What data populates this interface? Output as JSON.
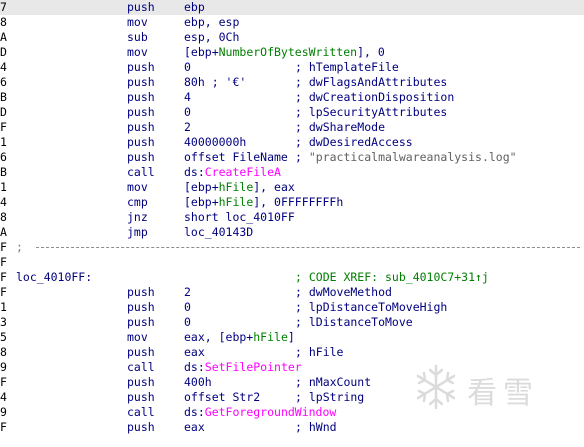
{
  "rows": [
    {
      "addr": "7",
      "label": "",
      "mnem": "push",
      "ops": [
        {
          "t": "ebp"
        }
      ],
      "comment": [],
      "hl": true
    },
    {
      "addr": "8",
      "label": "",
      "mnem": "mov",
      "ops": [
        {
          "t": "ebp, esp"
        }
      ],
      "comment": []
    },
    {
      "addr": "A",
      "label": "",
      "mnem": "sub",
      "ops": [
        {
          "t": "esp, 0Ch"
        }
      ],
      "comment": []
    },
    {
      "addr": "D",
      "label": "",
      "mnem": "mov",
      "ops": [
        {
          "t": "[ebp+"
        },
        {
          "t": "NumberOfBytesWritten",
          "c": "ref"
        },
        {
          "t": "], 0"
        }
      ],
      "comment": []
    },
    {
      "addr": "4",
      "label": "",
      "mnem": "push",
      "ops": [
        {
          "t": "0"
        }
      ],
      "comment": [
        {
          "t": "; hTemplateFile"
        }
      ]
    },
    {
      "addr": "6",
      "label": "",
      "mnem": "push",
      "ops": [
        {
          "t": "80h ; '€'"
        }
      ],
      "comment": [
        {
          "t": "; dwFlagsAndAttributes"
        }
      ]
    },
    {
      "addr": "B",
      "label": "",
      "mnem": "push",
      "ops": [
        {
          "t": "4"
        }
      ],
      "comment": [
        {
          "t": "; dwCreationDisposition"
        }
      ]
    },
    {
      "addr": "D",
      "label": "",
      "mnem": "push",
      "ops": [
        {
          "t": "0"
        }
      ],
      "comment": [
        {
          "t": "; lpSecurityAttributes"
        }
      ]
    },
    {
      "addr": "F",
      "label": "",
      "mnem": "push",
      "ops": [
        {
          "t": "2"
        }
      ],
      "comment": [
        {
          "t": "; dwShareMode"
        }
      ]
    },
    {
      "addr": "1",
      "label": "",
      "mnem": "push",
      "ops": [
        {
          "t": "40000000h"
        }
      ],
      "comment": [
        {
          "t": "; dwDesiredAccess"
        }
      ]
    },
    {
      "addr": "6",
      "label": "",
      "mnem": "push",
      "ops": [
        {
          "t": "offset FileName"
        }
      ],
      "comment": [
        {
          "t": "; "
        },
        {
          "t": "\"practicalmalwareanalysis.log\"",
          "c": "str"
        }
      ]
    },
    {
      "addr": "B",
      "label": "",
      "mnem": "call",
      "ops": [
        {
          "t": "ds:"
        },
        {
          "t": "CreateFileA",
          "c": "api"
        }
      ],
      "comment": []
    },
    {
      "addr": "1",
      "label": "",
      "mnem": "mov",
      "ops": [
        {
          "t": "[ebp+"
        },
        {
          "t": "hFile",
          "c": "ref"
        },
        {
          "t": "], eax"
        }
      ],
      "comment": []
    },
    {
      "addr": "4",
      "label": "",
      "mnem": "cmp",
      "ops": [
        {
          "t": "[ebp+"
        },
        {
          "t": "hFile",
          "c": "ref"
        },
        {
          "t": "], 0FFFFFFFFh"
        }
      ],
      "comment": []
    },
    {
      "addr": "8",
      "label": "",
      "mnem": "jnz",
      "ops": [
        {
          "t": "short loc_4010FF"
        }
      ],
      "comment": []
    },
    {
      "addr": "A",
      "label": "",
      "mnem": "jmp",
      "ops": [
        {
          "t": "loc_40143D"
        }
      ],
      "comment": []
    },
    {
      "addr": "F",
      "sep": ";"
    },
    {
      "addr": "F",
      "label": "",
      "mnem": "",
      "ops": [],
      "comment": []
    },
    {
      "addr": "F",
      "label": "loc_4010FF:",
      "mnem": "",
      "ops": [],
      "comment": [
        {
          "t": "; CODE XREF: sub_4010C7+31↑j"
        }
      ],
      "xref": true
    },
    {
      "addr": "F",
      "label": "",
      "mnem": "push",
      "ops": [
        {
          "t": "2"
        }
      ],
      "comment": [
        {
          "t": "; dwMoveMethod"
        }
      ]
    },
    {
      "addr": "1",
      "label": "",
      "mnem": "push",
      "ops": [
        {
          "t": "0"
        }
      ],
      "comment": [
        {
          "t": "; lpDistanceToMoveHigh"
        }
      ]
    },
    {
      "addr": "3",
      "label": "",
      "mnem": "push",
      "ops": [
        {
          "t": "0"
        }
      ],
      "comment": [
        {
          "t": "; lDistanceToMove"
        }
      ]
    },
    {
      "addr": "5",
      "label": "",
      "mnem": "mov",
      "ops": [
        {
          "t": "eax, [ebp+"
        },
        {
          "t": "hFile",
          "c": "ref"
        },
        {
          "t": "]"
        }
      ],
      "comment": []
    },
    {
      "addr": "8",
      "label": "",
      "mnem": "push",
      "ops": [
        {
          "t": "eax"
        }
      ],
      "comment": [
        {
          "t": "; hFile"
        }
      ]
    },
    {
      "addr": "9",
      "label": "",
      "mnem": "call",
      "ops": [
        {
          "t": "ds:"
        },
        {
          "t": "SetFilePointer",
          "c": "api"
        }
      ],
      "comment": []
    },
    {
      "addr": "F",
      "label": "",
      "mnem": "push",
      "ops": [
        {
          "t": "400h"
        }
      ],
      "comment": [
        {
          "t": "; nMaxCount"
        }
      ]
    },
    {
      "addr": "4",
      "label": "",
      "mnem": "push",
      "ops": [
        {
          "t": "offset Str2"
        }
      ],
      "comment": [
        {
          "t": "; lpString"
        }
      ]
    },
    {
      "addr": "9",
      "label": "",
      "mnem": "call",
      "ops": [
        {
          "t": "ds:"
        },
        {
          "t": "GetForegroundWindow",
          "c": "api"
        }
      ],
      "comment": []
    },
    {
      "addr": "F",
      "label": "",
      "mnem": "push",
      "ops": [
        {
          "t": "eax"
        }
      ],
      "comment": [
        {
          "t": "; hWnd"
        }
      ]
    }
  ],
  "watermark": {
    "icon": "snowflake-icon",
    "text": "看雪"
  }
}
